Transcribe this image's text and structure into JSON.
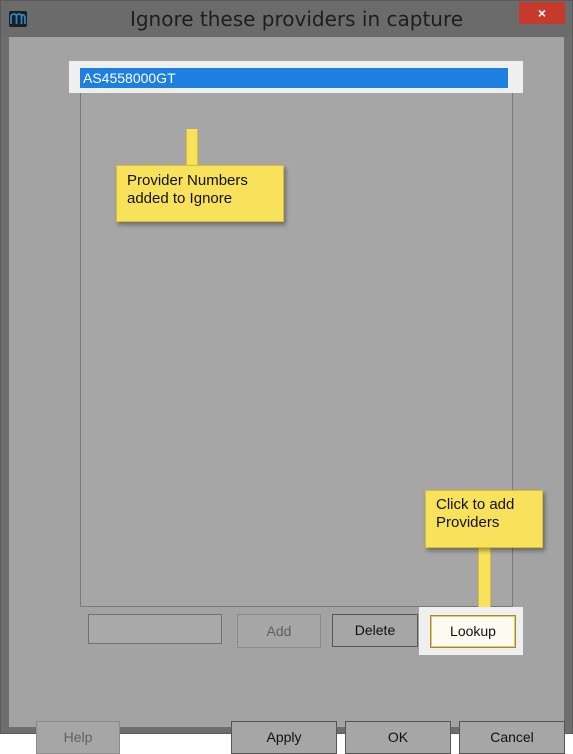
{
  "window": {
    "title": "Ignore these providers in capture",
    "close_label": "×"
  },
  "list": {
    "items": [
      "AS4558000GT"
    ],
    "selected_index": 0
  },
  "callouts": [
    {
      "text": "Provider Numbers\nadded to Ignore"
    },
    {
      "text": "Click to add\nProviders"
    }
  ],
  "input": {
    "value": "",
    "placeholder": ""
  },
  "buttons": {
    "add": "Add",
    "delete": "Delete",
    "lookup": "Lookup",
    "help": "Help",
    "apply": "Apply",
    "ok": "OK",
    "cancel": "Cancel"
  },
  "colors": {
    "selection": "#1d7fe0",
    "callout": "#f8e15b",
    "close_button": "#c63a2d"
  },
  "icons": {
    "app": "app-logo-icon",
    "close": "close-icon"
  }
}
